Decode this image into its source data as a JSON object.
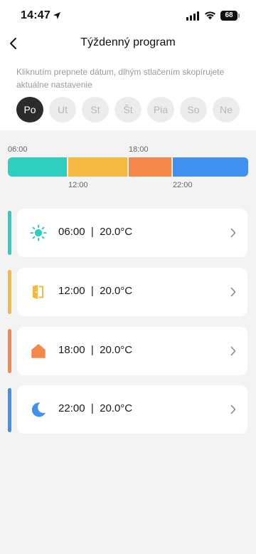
{
  "status_bar": {
    "time": "14:47",
    "battery": "68"
  },
  "header": {
    "title": "Týždenný program"
  },
  "hint": "Kliknutím prepnete dátum, dlhým stlačením skopírujete aktuálne nastavenie",
  "days": [
    {
      "label": "Po",
      "active": true
    },
    {
      "label": "Ut",
      "active": false
    },
    {
      "label": "St",
      "active": false
    },
    {
      "label": "Št",
      "active": false
    },
    {
      "label": "Pia",
      "active": false
    },
    {
      "label": "So",
      "active": false
    },
    {
      "label": "Ne",
      "active": false
    }
  ],
  "timeline": {
    "top_ticks": [
      "06:00",
      "18:00"
    ],
    "bottom_ticks": [
      "12:00",
      "22:00"
    ]
  },
  "colors": {
    "morning": "#2ecfc1",
    "day": "#f5b841",
    "evening": "#f4884a",
    "night": "#4090f0"
  },
  "schedule": [
    {
      "icon": "sun-icon",
      "time": "06:00",
      "temp": "20.0°C",
      "text": "06:00  |  20.0°C"
    },
    {
      "icon": "door-icon",
      "time": "12:00",
      "temp": "20.0°C",
      "text": "12:00  |  20.0°C"
    },
    {
      "icon": "home-icon",
      "time": "18:00",
      "temp": "20.0°C",
      "text": "18:00  |  20.0°C"
    },
    {
      "icon": "moon-icon",
      "time": "22:00",
      "temp": "20.0°C",
      "text": "22:00  |  20.0°C"
    }
  ]
}
